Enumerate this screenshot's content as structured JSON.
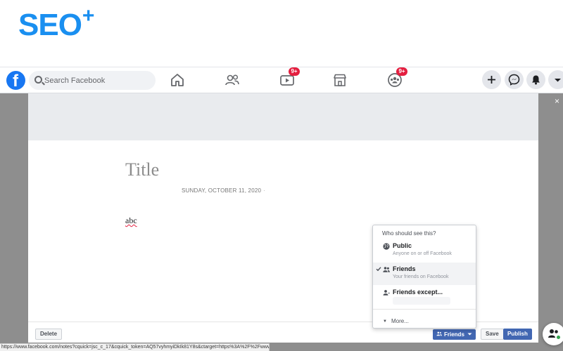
{
  "brand": {
    "text": "SEO",
    "plus": "+"
  },
  "facebook": {
    "logo": "f",
    "search_placeholder": "Search Facebook",
    "nav": [
      {
        "icon": "home-icon",
        "badge": ""
      },
      {
        "icon": "friends-icon",
        "badge": ""
      },
      {
        "icon": "watch-icon",
        "badge": "9+"
      },
      {
        "icon": "marketplace-icon",
        "badge": ""
      },
      {
        "icon": "groups-icon",
        "badge": "9+"
      }
    ],
    "right_buttons": [
      "plus-icon",
      "messenger-icon",
      "bell-icon",
      "caret-down-icon"
    ]
  },
  "note": {
    "title": "Title",
    "date": "SUNDAY, OCTOBER 11, 2020",
    "date_dot": "·",
    "body": "abc"
  },
  "privacy": {
    "header": "Who should see this?",
    "options": [
      {
        "title": "Public",
        "desc": "Anyone on or off Facebook",
        "icon": "globe-icon",
        "selected": false
      },
      {
        "title": "Friends",
        "desc": "Your friends on Facebook",
        "icon": "friends-icon",
        "selected": true
      },
      {
        "title": "Friends except...",
        "desc": "",
        "icon": "friend-except-icon",
        "selected": false
      }
    ],
    "more": "More..."
  },
  "footer": {
    "delete": "Delete",
    "audience": "Friends",
    "save": "Save",
    "publish": "Publish"
  },
  "close": "×",
  "status_url": "https://www.facebook.com/notes?cquick=jsc_c_17&cquick_token=AQ57vyhmyiDkIk81Y8s&ctarget=https%3A%2F%2Fwww.facebook.com#",
  "colors": {
    "fb_blue": "#1877f2",
    "button_blue": "#4267b2",
    "badge_red": "#e41e3f",
    "overlay": "#8e8e8e"
  }
}
